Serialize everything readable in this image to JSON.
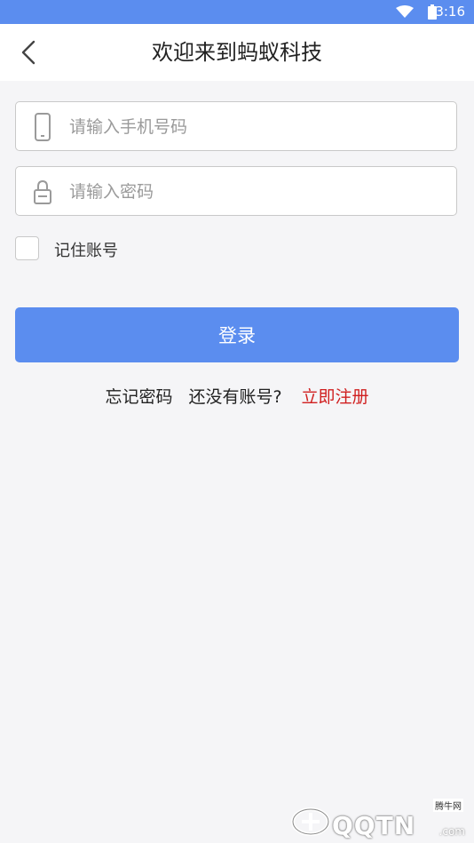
{
  "status_bar": {
    "time": "3:16",
    "wifi_icon": "wifi-icon",
    "battery_icon": "battery-icon"
  },
  "header": {
    "title": "欢迎来到蚂蚁科技",
    "back_icon": "chevron-left-icon"
  },
  "login_form": {
    "phone": {
      "placeholder": "请输入手机号码",
      "value": "",
      "icon": "phone-icon"
    },
    "password": {
      "placeholder": "请输入密码",
      "value": "",
      "icon": "lock-icon"
    },
    "remember": {
      "label": "记住账号",
      "checked": false
    },
    "submit_label": "登录"
  },
  "links": {
    "forgot_password": "忘记密码",
    "no_account": "还没有账号?",
    "register": "立即注册"
  },
  "watermark": {
    "brand": "QQTN",
    "sub": "腾牛网",
    "domain": ".com"
  },
  "colors": {
    "accent": "#5b8def",
    "link_red": "#d01f1f",
    "background": "#f5f5f7"
  }
}
